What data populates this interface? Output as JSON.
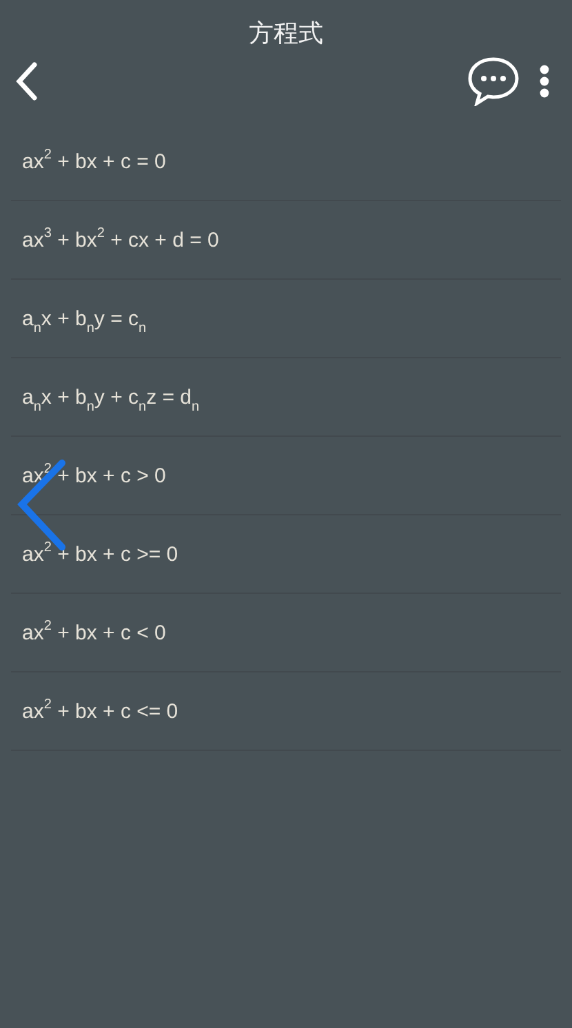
{
  "header": {
    "title": "方程式"
  },
  "equations": [
    {
      "text": "ax$^{2}$ + bx + c = 0"
    },
    {
      "text": "ax$^{3}$ + bx$^{2}$ + cx + d = 0"
    },
    {
      "text": "a$_{n}$x + b$_{n}$y = c$_{n}$"
    },
    {
      "text": "a$_{n}$x + b$_{n}$y + c$_{n}$z = d$_{n}$"
    },
    {
      "text": "ax$^{2}$ + bx + c > 0"
    },
    {
      "text": "ax$^{2}$ + bx + c >= 0"
    },
    {
      "text": "ax$^{2}$ + bx + c < 0"
    },
    {
      "text": "ax$^{2}$ + bx + c <= 0"
    }
  ]
}
